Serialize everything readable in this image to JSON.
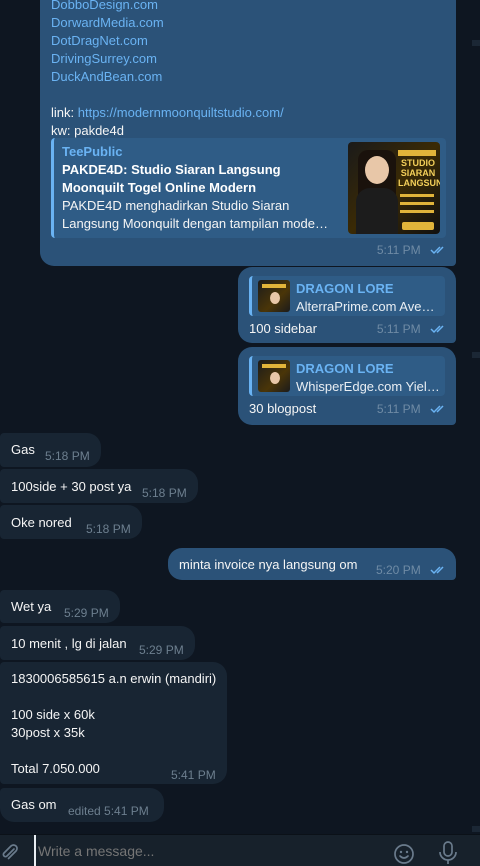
{
  "messages": {
    "m1": {
      "domains": [
        "DobboDesign.com",
        "DorwardMedia.com",
        "DotDragNet.com",
        "DrivingSurrey.com",
        "DuckAndBean.com"
      ],
      "link_label": "link:",
      "link_url": "https://modernmoonquiltstudio.com/",
      "kw": "kw: pakde4d",
      "preview": {
        "site": "TeePublic",
        "title_line1": "PAKDE4D: Studio Siaran Langsung",
        "title_line2": "Moonquilt Togel Online Modern",
        "desc_line1": "PAKDE4D menghadirkan Studio Siaran",
        "desc_line2": "Langsung Moonquilt dengan tampilan mode…",
        "thumb_text": "STUDIO SIARAN LANGSUNG"
      },
      "time": "5:11 PM"
    },
    "m2": {
      "reply_title": "DRAGON LORE",
      "reply_sub": "AlterraPrime.com Ave…",
      "text": "100 sidebar",
      "time": "5:11 PM"
    },
    "m3": {
      "reply_title": "DRAGON LORE",
      "reply_sub": "WhisperEdge.com Yiel…",
      "text": "30 blogpost",
      "time": "5:11 PM"
    },
    "m4": {
      "text": "Gas",
      "time": "5:18 PM"
    },
    "m5": {
      "text": "100side + 30 post ya",
      "time": "5:18 PM"
    },
    "m6": {
      "text": "Oke nored",
      "time": "5:18 PM"
    },
    "m7": {
      "text": "minta invoice nya langsung om",
      "time": "5:20 PM"
    },
    "m8": {
      "text": "Wet ya",
      "time": "5:29 PM"
    },
    "m9": {
      "text": "10 menit , lg di jalan",
      "time": "5:29 PM"
    },
    "m10": {
      "line1": "1830006585615 a.n erwin (mandiri)",
      "line2": "100 side x 60k",
      "line3": "30post x 35k",
      "line4": "Total 7.050.000",
      "time": "5:41 PM"
    },
    "m11": {
      "text": "Gas om",
      "time": "edited 5:41 PM"
    }
  },
  "composer": {
    "placeholder": "Write a message..."
  },
  "icons": {
    "attach": "paperclip-icon",
    "emoji": "emoji-icon",
    "mic": "microphone-icon",
    "read": "double-check-icon"
  },
  "colors": {
    "bg": "#0e1621",
    "outgoing": "#2b5278",
    "incoming": "#182533",
    "link": "#6ab3f3"
  }
}
